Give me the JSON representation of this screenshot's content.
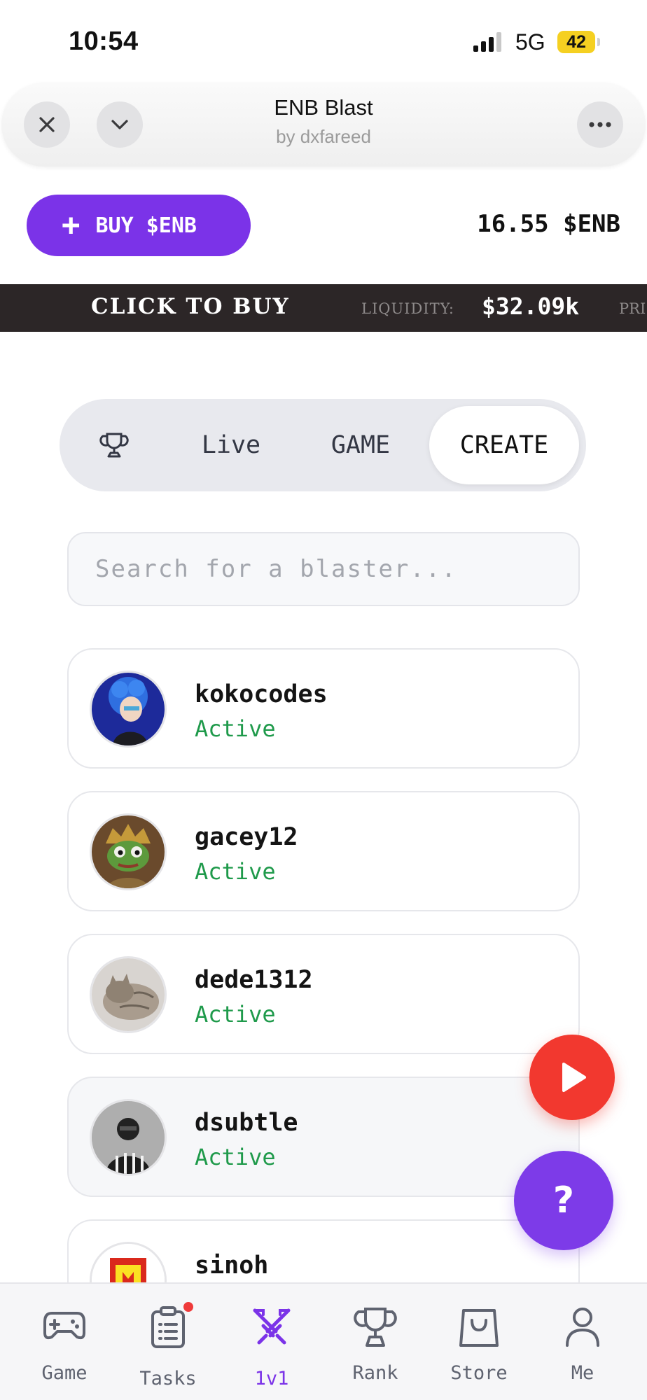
{
  "status_bar": {
    "time": "10:54",
    "network": "5G",
    "battery": "42"
  },
  "header": {
    "title": "ENB Blast",
    "subtitle": "by dxfareed"
  },
  "buy": {
    "label": "BUY $ENB",
    "balance": "16.55 $ENB"
  },
  "ticker": {
    "cta": "CLICK TO BUY",
    "liquidity_label": "LIQUIDITY:",
    "liquidity_value": "$32.09k",
    "next_label": "PRI"
  },
  "tabs": [
    {
      "label": "Live"
    },
    {
      "label": "GAME"
    },
    {
      "label": "CREATE",
      "active": true
    }
  ],
  "search": {
    "placeholder": "Search for a blaster..."
  },
  "users": [
    {
      "name": "kokocodes",
      "status": "Active"
    },
    {
      "name": "gacey12",
      "status": "Active"
    },
    {
      "name": "dede1312",
      "status": "Active"
    },
    {
      "name": "dsubtle",
      "status": "Active"
    },
    {
      "name": "sinoh",
      "status": ""
    }
  ],
  "fab": {
    "help": "?"
  },
  "nav": [
    {
      "label": "Game",
      "icon": "gamepad-icon"
    },
    {
      "label": "Tasks",
      "icon": "clipboard-icon"
    },
    {
      "label": "1v1",
      "icon": "crossed-swords-icon",
      "active": true
    },
    {
      "label": "Rank",
      "icon": "trophy-icon"
    },
    {
      "label": "Store",
      "icon": "shopping-bag-icon"
    },
    {
      "label": "Me",
      "icon": "person-icon"
    }
  ],
  "colors": {
    "accent": "#7b33e8",
    "active_status": "#1f9a4b",
    "play_button": "#f2382f"
  }
}
